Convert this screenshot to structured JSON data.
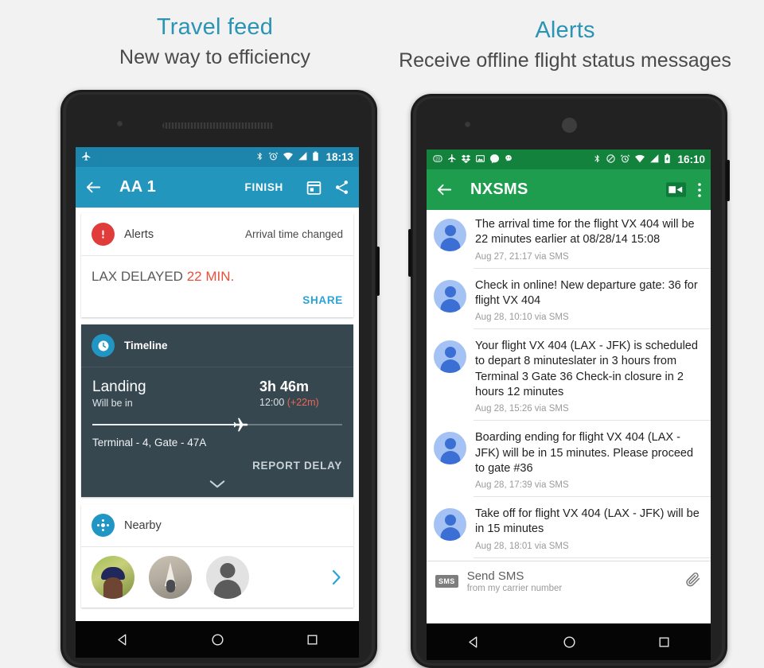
{
  "panels": {
    "left": {
      "title": "Travel feed",
      "subtitle": "New way to efficiency"
    },
    "right": {
      "title": "Alerts",
      "subtitle": "Receive offline flight status messages"
    }
  },
  "colors": {
    "accent_heading": "#2a94b5",
    "left_appbar": "#2396bd",
    "left_statusbar": "#1d85ac",
    "right_appbar": "#1f9d4e",
    "right_statusbar": "#13823d",
    "alert_red": "#e03c3c",
    "delay_red": "#e8503a",
    "timeline_bg": "#37474f",
    "link_blue": "#2aa3d6",
    "page_bg": "#f2f2f2"
  },
  "left_phone": {
    "status_bar": {
      "time": "18:13",
      "left_icons": [
        "airplane-icon"
      ],
      "right_icons": [
        "bluetooth-icon",
        "alarm-icon",
        "wifi-icon",
        "signal-icon",
        "battery-icon"
      ]
    },
    "app_bar": {
      "back_icon": "back-arrow-icon",
      "title": "AA 1",
      "finish_label": "FINISH",
      "calendar_icon": "calendar-icon",
      "share_icon": "share-icon"
    },
    "alerts_card": {
      "icon": "alert-exclamation-icon",
      "title": "Alerts",
      "status": "Arrival time changed",
      "message_prefix": "LAX DELAYED ",
      "message_highlight": "22 MIN.",
      "share_label": "SHARE"
    },
    "timeline_card": {
      "icon": "clock-icon",
      "title": "Timeline",
      "event": "Landing",
      "event_sub": "Will be in",
      "duration": "3h 46m",
      "time": "12:00 ",
      "delay": "(+22m)",
      "progress_percent": 59,
      "plane_icon": "airplane-icon",
      "gate_info": "Terminal - 4, Gate - 47A",
      "report_label": "REPORT DELAY",
      "expand_icon": "chevron-down-icon"
    },
    "nearby_card": {
      "icon": "nearby-hub-icon",
      "title": "Nearby",
      "avatars": [
        "avatar-photo-cap",
        "avatar-photo-tent",
        "avatar-default-silhouette"
      ],
      "more_icon": "chevron-right-icon"
    },
    "nav_bar": {
      "back": "back-triangle-icon",
      "home": "home-circle-icon",
      "recents": "recents-square-icon"
    }
  },
  "right_phone": {
    "status_bar": {
      "time": "16:10",
      "left_icons": [
        "notification-count-icon",
        "airplane-icon",
        "dropbox-icon",
        "photo-icon",
        "messenger-icon",
        "app-icon"
      ],
      "right_icons": [
        "bluetooth-icon",
        "do-not-disturb-icon",
        "alarm-icon",
        "wifi-icon",
        "signal-icon",
        "battery-charging-icon"
      ]
    },
    "app_bar": {
      "back_icon": "back-arrow-icon",
      "title": "NXSMS",
      "video_icon": "video-camera-icon",
      "overflow_icon": "overflow-menu-icon"
    },
    "messages": [
      {
        "avatar": "contact-avatar",
        "text": "The arrival time for the flight VX 404 will be 22 minutes earlier at 08/28/14 15:08",
        "meta": "Aug 27, 21:17 via SMS"
      },
      {
        "avatar": "contact-avatar",
        "text": "Check in online! New departure gate: 36 for flight VX 404",
        "meta": "Aug 28, 10:10 via SMS"
      },
      {
        "avatar": "contact-avatar",
        "text": "Your flight VX 404 (LAX - JFK) is scheduled to depart 8 minuteslater in 3 hours from Terminal 3 Gate 36 Check-in closure in 2 hours 12 minutes",
        "meta": "Aug 28, 15:26 via SMS"
      },
      {
        "avatar": "contact-avatar",
        "text": "Boarding ending for flight VX 404 (LAX - JFK) will be in 15 minutes. Please proceed to gate #36",
        "meta": "Aug 28, 17:39 via SMS"
      },
      {
        "avatar": "contact-avatar",
        "text": "Take off for flight VX 404 (LAX - JFK) will be in 15 minutes",
        "meta": "Aug 28, 18:01 via SMS"
      }
    ],
    "compose": {
      "badge": "SMS",
      "title": "Send SMS",
      "subtitle": "from my carrier number",
      "attach_icon": "paperclip-icon"
    },
    "nav_bar": {
      "back": "back-triangle-icon",
      "home": "home-circle-icon",
      "recents": "recents-square-icon"
    }
  }
}
